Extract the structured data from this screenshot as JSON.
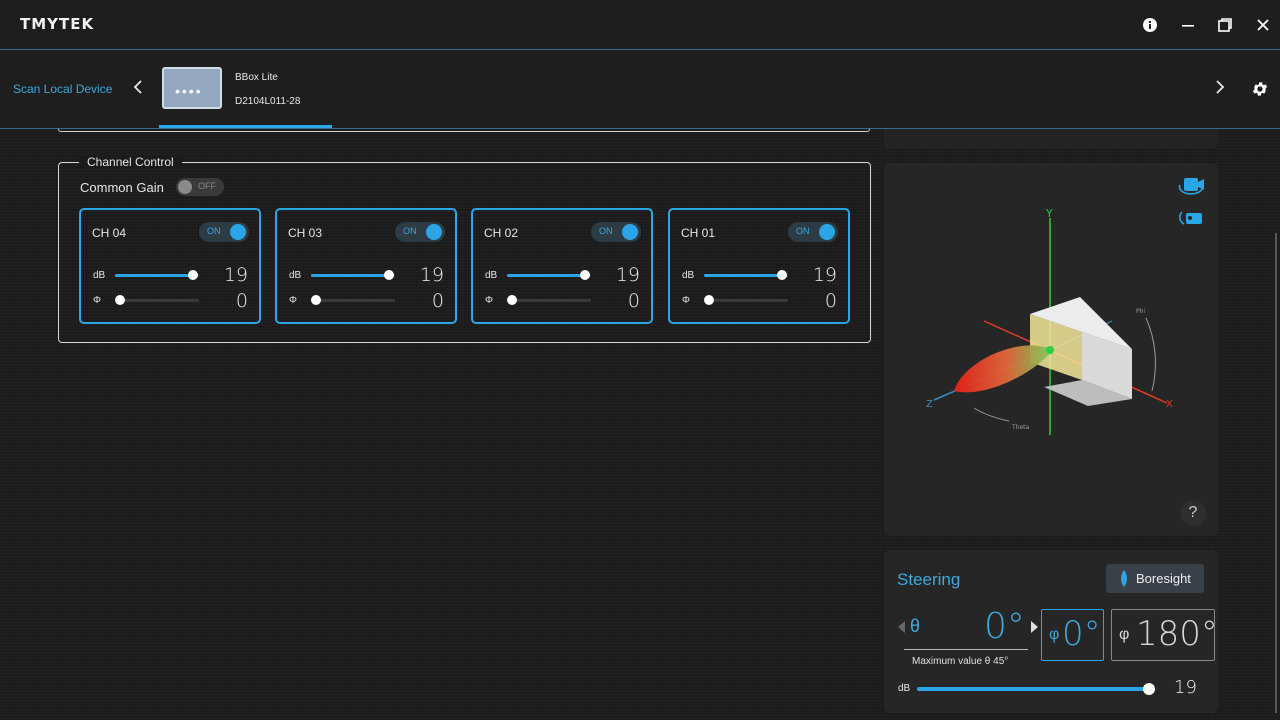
{
  "app": {
    "logo": "TMYTEK"
  },
  "titlebar": {
    "info_icon": "info-icon",
    "minimize_icon": "minimize-icon",
    "restore_icon": "restore-icon",
    "close_icon": "close-icon"
  },
  "device_bar": {
    "scan_label": "Scan Local Device",
    "device": {
      "name": "BBox Lite",
      "serial": "D2104L011-28",
      "thumb": "••••"
    },
    "accent": "#2aa6e6"
  },
  "channel_control": {
    "title": "Channel Control",
    "common_gain": {
      "label": "Common Gain",
      "state": "OFF"
    },
    "channels": [
      {
        "name": "CH 04",
        "state": "ON",
        "db_label": "dB",
        "db_value": "19",
        "db_fill": 0.93,
        "phase_label": "Φ",
        "phase_value": "0",
        "phase_fill": 0.06
      },
      {
        "name": "CH 03",
        "state": "ON",
        "db_label": "dB",
        "db_value": "19",
        "db_fill": 0.93,
        "phase_label": "Φ",
        "phase_value": "0",
        "phase_fill": 0.06
      },
      {
        "name": "CH 02",
        "state": "ON",
        "db_label": "dB",
        "db_value": "19",
        "db_fill": 0.93,
        "phase_label": "Φ",
        "phase_value": "0",
        "phase_fill": 0.06
      },
      {
        "name": "CH 01",
        "state": "ON",
        "db_label": "dB",
        "db_value": "19",
        "db_fill": 0.93,
        "phase_label": "Φ",
        "phase_value": "0",
        "phase_fill": 0.06
      }
    ]
  },
  "viewer": {
    "axes": {
      "x": "X",
      "y": "Y",
      "z": "Z",
      "phi": "Phi",
      "theta": "Theta"
    },
    "help": "?"
  },
  "steering": {
    "title": "Steering",
    "boresight_label": "Boresight",
    "theta_symbol": "θ",
    "theta_value": "0°",
    "theta_note": "Maximum value θ 45°",
    "phi_symbol": "φ",
    "phi_value_1": "0°",
    "phi_value_2": "180°",
    "db_label": "dB",
    "db_value": "19",
    "db_fill": 0.99
  }
}
